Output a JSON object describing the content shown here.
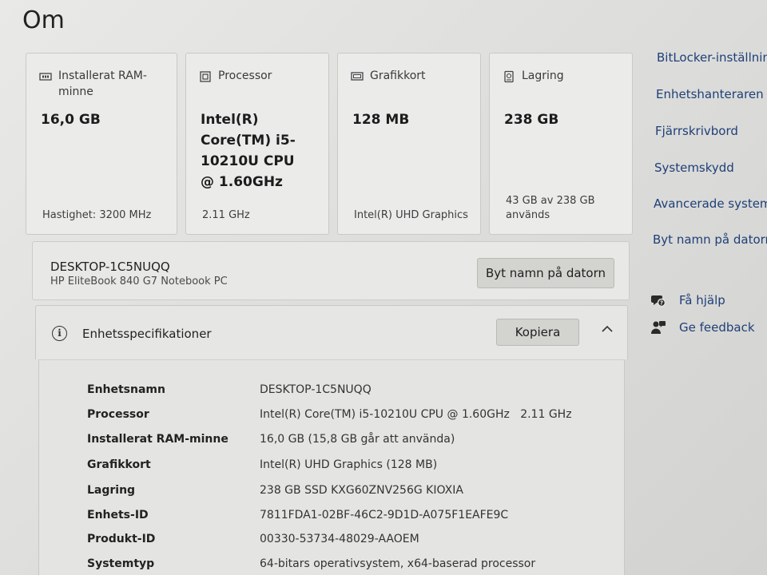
{
  "page": {
    "title": "Om"
  },
  "cards": [
    {
      "header": "Installerat RAM-minne",
      "value": "16,0 GB",
      "sub": "Hastighet: 3200 MHz"
    },
    {
      "header": "Processor",
      "value": "Intel(R) Core(TM) i5-10210U CPU @ 1.60GHz",
      "sub": "2.11 GHz"
    },
    {
      "header": "Grafikkort",
      "value": "128 MB",
      "sub": "Intel(R) UHD Graphics"
    },
    {
      "header": "Lagring",
      "value": "238 GB",
      "sub": "43 GB av 238 GB används"
    }
  ],
  "device": {
    "name": "DESKTOP-1C5NUQQ",
    "model": "HP EliteBook 840 G7 Notebook PC",
    "rename_label": "Byt namn på datorn"
  },
  "specs": {
    "title": "Enhetsspecifikationer",
    "copy_label": "Kopiera",
    "rows": [
      {
        "label": "Enhetsnamn",
        "value": "DESKTOP-1C5NUQQ"
      },
      {
        "label": "Processor",
        "value": "Intel(R) Core(TM) i5-10210U CPU @ 1.60GHz   2.11 GHz"
      },
      {
        "label": "Installerat RAM-minne",
        "value": "16,0 GB (15,8 GB går att använda)"
      },
      {
        "label": "Grafikkort",
        "value": "Intel(R) UHD Graphics (128 MB)"
      },
      {
        "label": "Lagring",
        "value": "238 GB SSD KXG60ZNV256G KIOXIA"
      },
      {
        "label": "Enhets-ID",
        "value": "7811FDA1-02BF-46C2-9D1D-A075F1EAFE9C"
      },
      {
        "label": "Produkt-ID",
        "value": "00330-53734-48029-AAOEM"
      },
      {
        "label": "Systemtyp",
        "value": "64-bitars operativsystem, x64-baserad processor"
      }
    ]
  },
  "sidebar": {
    "links": [
      "BitLocker-inställnin",
      "Enhetshanteraren",
      "Fjärrskrivbord",
      "Systemskydd",
      "Avancerade systemi",
      "Byt namn på datorn"
    ],
    "help": "Få hjälp",
    "feedback": "Ge feedback"
  }
}
